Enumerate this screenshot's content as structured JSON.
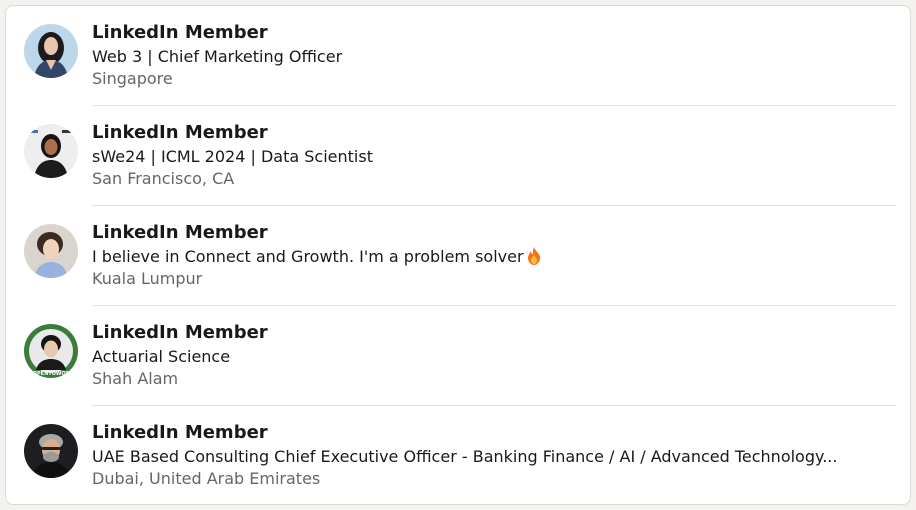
{
  "members": [
    {
      "name": "LinkedIn Member",
      "headline": "Web 3 | Chief Marketing Officer",
      "location": "Singapore",
      "avatar_icon": "profile-photo-icon"
    },
    {
      "name": "LinkedIn Member",
      "headline": "sWe24 | ICML 2024 | Data Scientist",
      "location": "San Francisco, CA",
      "avatar_icon": "profile-photo-icon"
    },
    {
      "name": "LinkedIn Member",
      "headline": "I believe in Connect and Growth. I'm a problem solver",
      "headline_emoji": "fire-icon",
      "location": "Kuala Lumpur",
      "avatar_icon": "profile-photo-icon"
    },
    {
      "name": "LinkedIn Member",
      "headline": "Actuarial Science",
      "location": "Shah Alam",
      "avatar_icon": "profile-photo-icon",
      "avatar_badge": "#OPENTOWORK"
    },
    {
      "name": "LinkedIn Member",
      "headline": "UAE Based Consulting Chief Executive Officer - Banking Finance / AI / Advanced Technology...",
      "location": "Dubai, United Arab Emirates",
      "avatar_icon": "profile-photo-icon"
    }
  ],
  "colors": {
    "name_text": "#191919",
    "secondary_text": "#666666",
    "divider": "#e6e4e0",
    "open_to_work_ring": "#3a7d3a"
  }
}
